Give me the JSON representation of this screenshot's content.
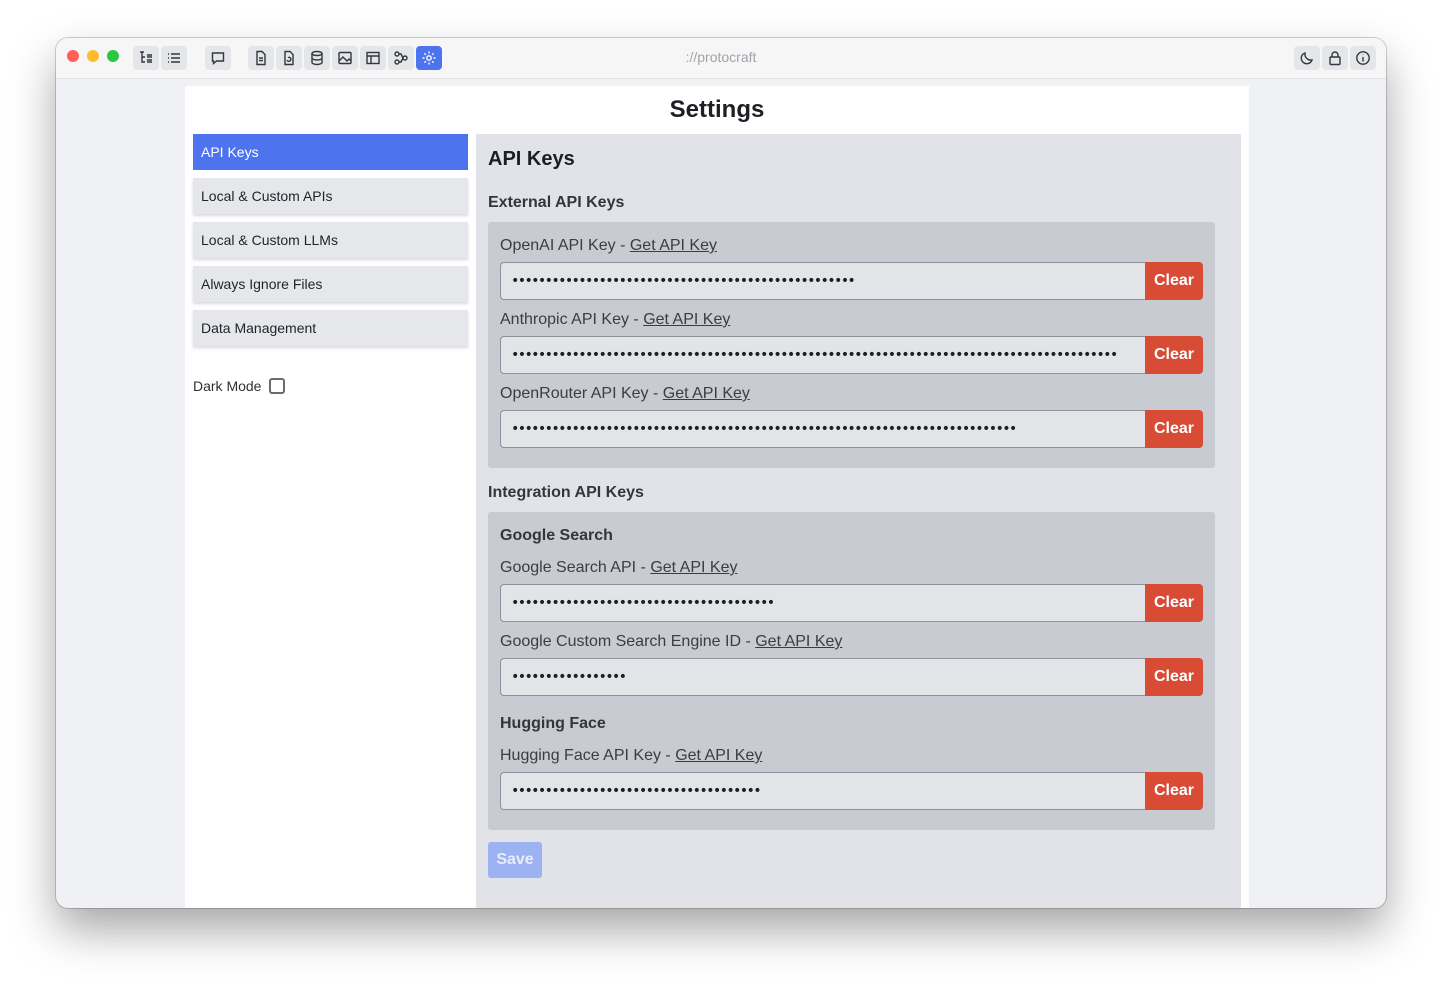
{
  "window": {
    "url": "://protocraft"
  },
  "toolbar": {
    "left_icons": [
      "tree-icon",
      "list-icon",
      "chat-icon",
      "document-icon",
      "file-refresh-icon",
      "database-icon",
      "image-icon",
      "layout-icon",
      "flow-icon",
      "gear-icon"
    ],
    "right_icons": [
      "moon-icon",
      "lock-icon",
      "info-icon"
    ],
    "active_icon": "gear-icon",
    "accent_color": "#4d74ee"
  },
  "settings": {
    "title": "Settings",
    "nav": [
      {
        "label": "API Keys",
        "active": true
      },
      {
        "label": "Local & Custom APIs",
        "active": false
      },
      {
        "label": "Local & Custom LLMs",
        "active": false
      },
      {
        "label": "Always Ignore Files",
        "active": false
      },
      {
        "label": "Data Management",
        "active": false
      }
    ],
    "dark_mode": {
      "label": "Dark Mode",
      "checked": false
    }
  },
  "main": {
    "heading": "API Keys",
    "external_heading": "External API Keys",
    "external_keys": [
      {
        "label": "OpenAI API Key - ",
        "link": "Get API Key",
        "value": "•••••••••••••••••••••••••••••••••••••••••••••••••••",
        "clear": "Clear"
      },
      {
        "label": "Anthropic API Key - ",
        "link": "Get API Key",
        "value": "••••••••••••••••••••••••••••••••••••••••••••••••••••••••••••••••••••••••••••••••••••••••••",
        "clear": "Clear"
      },
      {
        "label": "OpenRouter API Key - ",
        "link": "Get API Key",
        "value": "•••••••••••••••••••••••••••••••••••••••••••••••••••••••••••••••••••••••••••",
        "clear": "Clear"
      }
    ],
    "integration_heading": "Integration API Keys",
    "google": {
      "title": "Google Search",
      "keys": [
        {
          "label": "Google Search API - ",
          "link": "Get API Key",
          "value": "•••••••••••••••••••••••••••••••••••••••",
          "clear": "Clear"
        },
        {
          "label": "Google Custom Search Engine ID - ",
          "link": "Get API Key",
          "value": "•••••••••••••••••",
          "clear": "Clear"
        }
      ]
    },
    "huggingface": {
      "title": "Hugging Face",
      "keys": [
        {
          "label": "Hugging Face API Key - ",
          "link": "Get API Key",
          "value": "•••••••••••••••••••••••••••••••••••••",
          "clear": "Clear"
        }
      ]
    },
    "save_label": "Save"
  }
}
